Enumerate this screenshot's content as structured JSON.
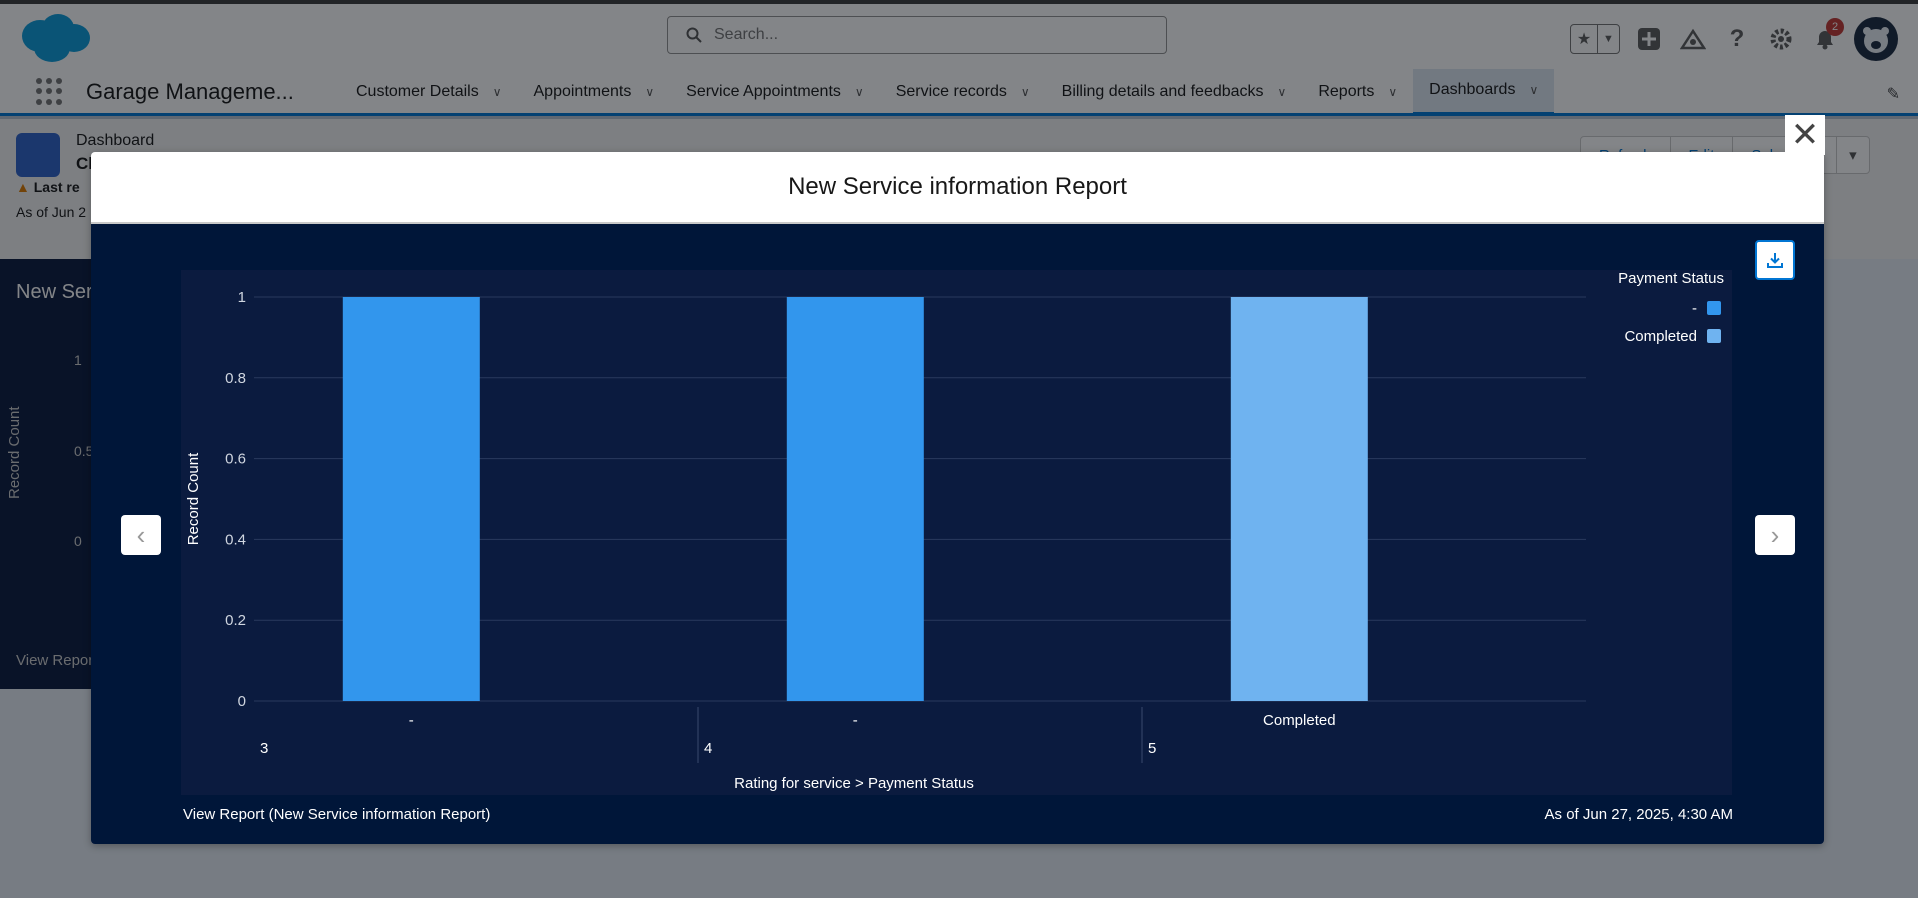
{
  "header": {
    "search_placeholder": "Search...",
    "notification_count": "2",
    "icons": [
      "salesforce-cloud-icon",
      "search-icon",
      "star-icon",
      "chevron-down-icon",
      "plus-icon",
      "trailhead-icon",
      "help-icon",
      "gear-icon",
      "bell-icon",
      "avatar"
    ]
  },
  "nav": {
    "app_name": "Garage Manageme...",
    "items": [
      {
        "label": "Customer Details"
      },
      {
        "label": "Appointments"
      },
      {
        "label": "Service Appointments"
      },
      {
        "label": "Service records"
      },
      {
        "label": "Billing details and feedbacks"
      },
      {
        "label": "Reports"
      },
      {
        "label": "Dashboards"
      }
    ]
  },
  "page": {
    "object_type": "Dashboard",
    "name": "Cl",
    "last_refreshed": "Last re",
    "as_of": "As of Jun 2",
    "buttons": [
      "Refresh",
      "Edit",
      "Subscribe",
      "▾"
    ]
  },
  "bg_card": {
    "title": "New Ser",
    "ylabel": "Record Count",
    "ticks": [
      "1",
      "0.5",
      "0"
    ],
    "link": "View Repor"
  },
  "modal": {
    "title": "New Service information Report",
    "footer_link": "View Report (New Service information Report)",
    "as_of": "As of Jun 27, 2025, 4:30 AM"
  },
  "chart_data": {
    "type": "bar",
    "ylabel": "Record Count",
    "xlabel": "Rating for service  >  Payment Status",
    "ylim": [
      0,
      1
    ],
    "yticks": [
      0,
      0.2,
      0.4,
      0.6,
      0.8,
      1
    ],
    "grid": true,
    "legend_title": "Payment Status",
    "legend_position": "top-right",
    "legend": [
      {
        "name": "-",
        "color": "#3296ed"
      },
      {
        "name": "Completed",
        "color": "#6fb3f0"
      }
    ],
    "groups": [
      {
        "label": "3",
        "bars": [
          {
            "category": "-",
            "value": 1,
            "color": "#3296ed"
          }
        ]
      },
      {
        "label": "4",
        "bars": [
          {
            "category": "-",
            "value": 1,
            "color": "#3296ed"
          }
        ]
      },
      {
        "label": "5",
        "bars": [
          {
            "category": "Completed",
            "value": 1,
            "color": "#6fb3f0"
          }
        ]
      }
    ]
  }
}
